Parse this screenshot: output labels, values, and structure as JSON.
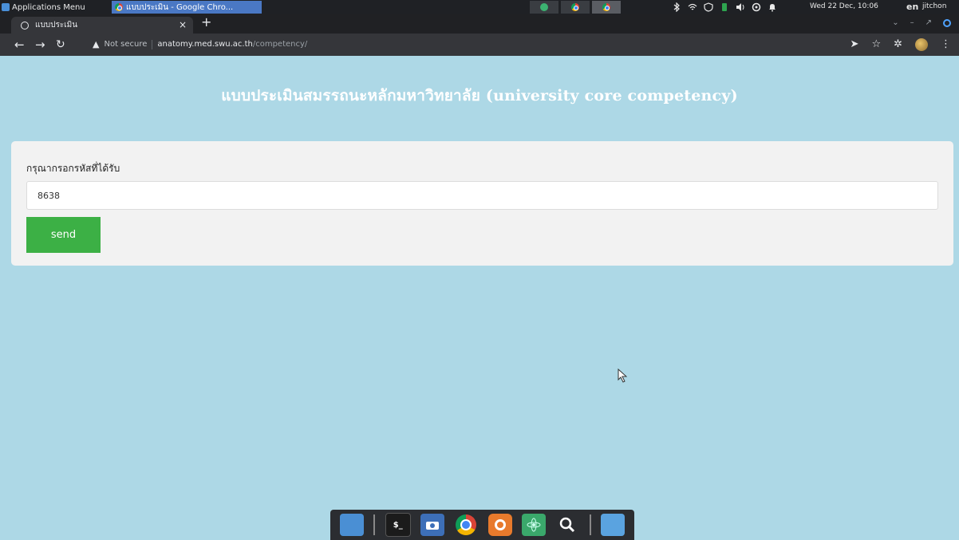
{
  "system_bar": {
    "apps_menu": "Applications Menu",
    "window_task": "แบบประเมิน - Google Chro...",
    "clock": "Wed 22 Dec, 10:06",
    "language": "en",
    "user": "jitchon"
  },
  "browser": {
    "tab_title": "แบบประเมิน",
    "tab_close": "×",
    "new_tab": "+",
    "security_label": "Not secure",
    "url_host": "anatomy.med.swu.ac.th",
    "url_path": "/competency/"
  },
  "page": {
    "title": "แบบประเมินสมรรถนะหลักมหาวิทยาลัย (university core competency)",
    "form": {
      "label": "กรุณากรอกรหัสที่ได้รับ",
      "code_value": "8638",
      "send_label": "send"
    }
  },
  "colors": {
    "page_background": "#add8e6",
    "send_button": "#3cb045",
    "card_background": "#f2f2f2"
  }
}
